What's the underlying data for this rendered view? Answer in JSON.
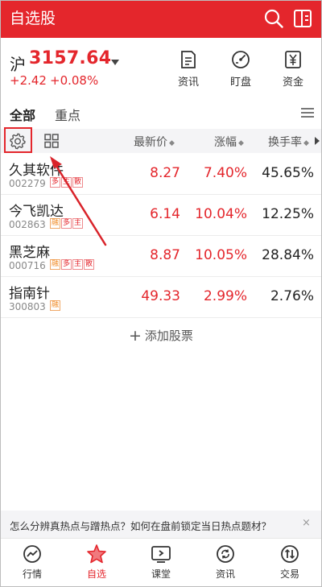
{
  "header": {
    "title": "自选股"
  },
  "index": {
    "name": "沪",
    "value": "3157.64",
    "change": "+2.42",
    "change_pct": "+0.08%"
  },
  "tools": [
    {
      "label": "资讯",
      "icon": "news-icon"
    },
    {
      "label": "盯盘",
      "icon": "monitor-icon"
    },
    {
      "label": "资金",
      "icon": "fund-icon"
    }
  ],
  "tabs": {
    "all": "全部",
    "focus": "重点"
  },
  "columns": {
    "price": "最新价",
    "change": "涨幅",
    "turnover": "换手率",
    "sort_glyph": "◆"
  },
  "stocks": [
    {
      "name": "久其软件",
      "code": "002279",
      "tags": [
        "多",
        "主",
        "散"
      ],
      "price": "8.27",
      "change": "7.40%",
      "turnover": "45.65%"
    },
    {
      "name": "今飞凯达",
      "code": "002863",
      "tags": [
        "融",
        "多",
        "主"
      ],
      "price": "6.14",
      "change": "10.04%",
      "turnover": "12.25%"
    },
    {
      "name": "黑芝麻",
      "code": "000716",
      "tags": [
        "融",
        "多",
        "主",
        "散"
      ],
      "price": "8.87",
      "change": "10.05%",
      "turnover": "28.84%"
    },
    {
      "name": "指南针",
      "code": "300803",
      "tags": [
        "融"
      ],
      "price": "49.33",
      "change": "2.99%",
      "turnover": "2.76%"
    }
  ],
  "add_stock": {
    "plus": "+",
    "label": "添加股票"
  },
  "banner": {
    "text": "怎么分辨真热点与蹭热点？如何在盘前锁定当日热点题材？",
    "close": "×"
  },
  "nav": [
    {
      "label": "行情",
      "icon": "market-icon",
      "active": false
    },
    {
      "label": "自选",
      "icon": "star-icon",
      "active": true
    },
    {
      "label": "课堂",
      "icon": "classroom-icon",
      "active": false
    },
    {
      "label": "资讯",
      "icon": "news-refresh-icon",
      "active": false
    },
    {
      "label": "交易",
      "icon": "trade-icon",
      "active": false
    }
  ],
  "colors": {
    "brand": "#e4262c",
    "up": "#e4262c",
    "tag_orange": "#f08a24"
  }
}
